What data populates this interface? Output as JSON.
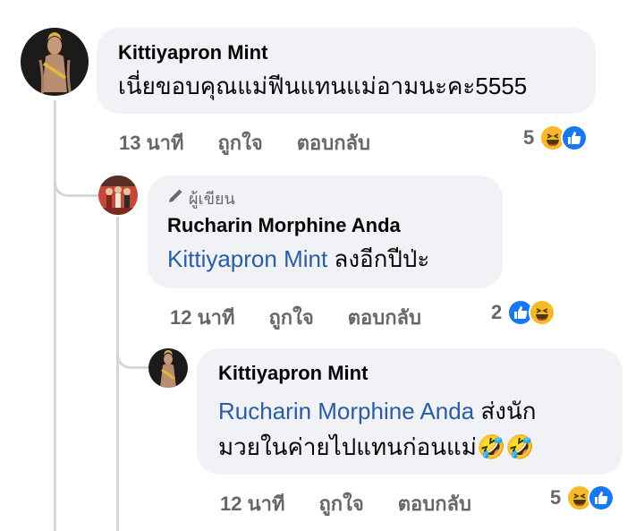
{
  "comments": [
    {
      "author": "Kittiyapron Mint",
      "text": "เนี่ยขอบคุณแม่ฟีนแทนแม่อามนะคะ5555",
      "time": "13 นาที",
      "like_label": "ถูกใจ",
      "reply_label": "ตอบกลับ",
      "reaction_count": "5",
      "reactions": [
        "haha-icon",
        "like-icon"
      ]
    },
    {
      "badge": "ผู้เขียน",
      "badge_icon": "pencil-icon",
      "author": "Rucharin Morphine Anda",
      "mention": "Kittiyapron Mint",
      "text": " ลงอีกปีป่ะ",
      "time": "12 นาที",
      "like_label": "ถูกใจ",
      "reply_label": "ตอบกลับ",
      "reaction_count": "2",
      "reactions": [
        "like-icon",
        "haha-icon"
      ]
    },
    {
      "author": "Kittiyapron Mint",
      "mention": "Rucharin Morphine Anda",
      "text_line1": " ส่งนัก",
      "text_line2": "มวยในค่ายไปแทนก่อนแม่",
      "text_emoji": "🤣🤣",
      "time": "12 นาที",
      "like_label": "ถูกใจ",
      "reply_label": "ตอบกลับ",
      "reaction_count": "5",
      "reactions": [
        "haha-icon",
        "like-icon"
      ]
    }
  ],
  "colors": {
    "bubble": "#f0f2f5",
    "mention": "#2a5ca8",
    "meta": "#65676b",
    "like": "#1877f2",
    "haha": "#f7b928"
  }
}
